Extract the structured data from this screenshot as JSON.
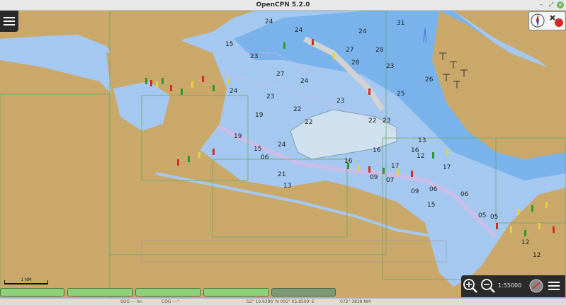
{
  "window": {
    "title": "OpenCPN 5.2.0"
  },
  "chart": {
    "depth_soundings": [
      "24",
      "24",
      "24",
      "15",
      "23",
      "27",
      "28",
      "31",
      "27",
      "28",
      "23",
      "24",
      "24",
      "23",
      "22",
      "23",
      "25",
      "26",
      "19",
      "22",
      "24",
      "23",
      "19",
      "15",
      "06",
      "22",
      "21",
      "16",
      "16",
      "16",
      "12",
      "13",
      "17",
      "17",
      "09",
      "07",
      "09",
      "06",
      "06",
      "05",
      "15",
      "13",
      "12",
      "12",
      "05"
    ],
    "scale_label": "1 NM"
  },
  "zoom": {
    "scale": "1:55000"
  },
  "status": {
    "sog": "SOG --- kn",
    "cog": "COG ---°",
    "position": "52° 19.6386' N 005° 05.8509' E",
    "cursor": "072° 3838 NM"
  },
  "colors": {
    "land": "#c9a86a",
    "deep_water": "#a5c8f0",
    "shallow_water": "#7ab3ec",
    "drying": "#9cc79a",
    "piano_active": "#8fd07a",
    "piano_inactive": "#7d9a77"
  }
}
